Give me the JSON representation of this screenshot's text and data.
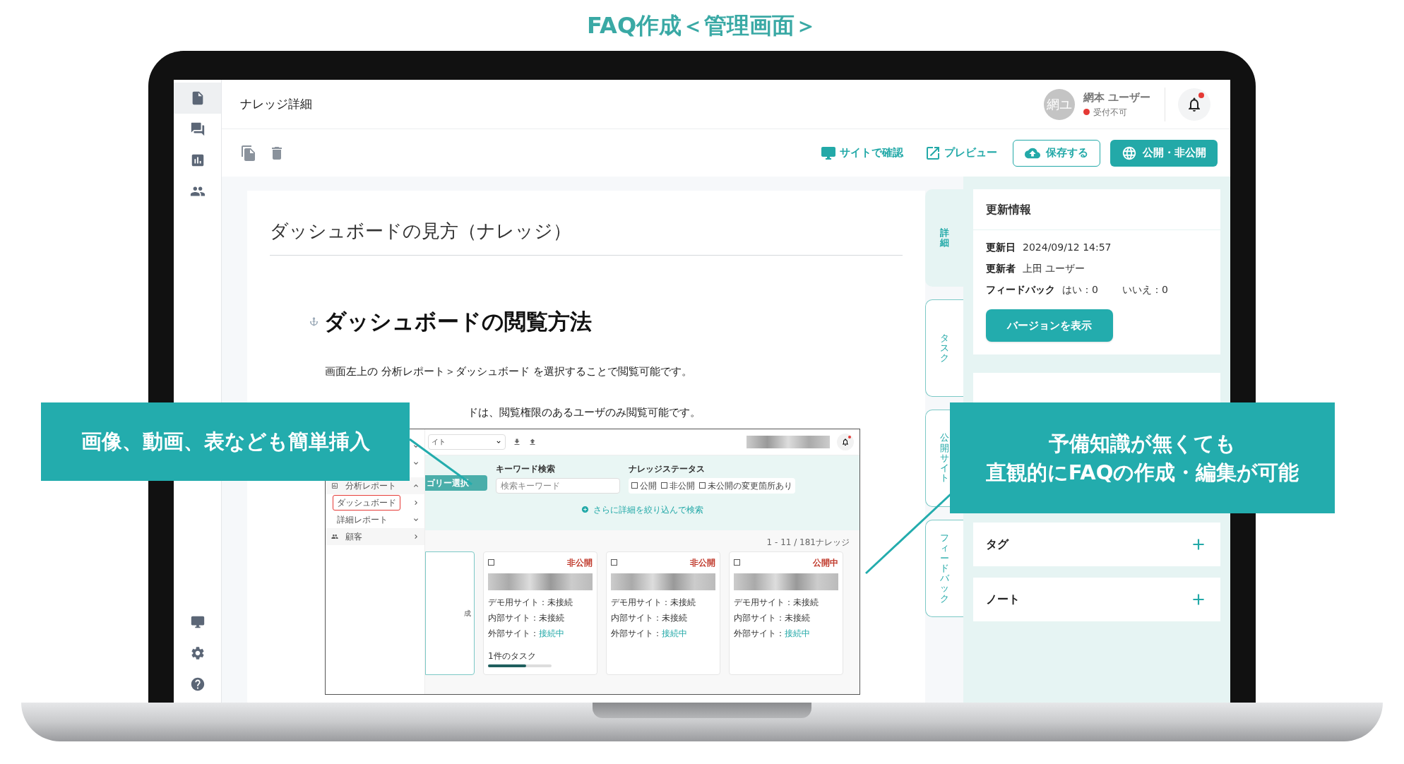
{
  "page_title": "FAQ作成＜管理画面＞",
  "sidebar": {
    "top": [
      {
        "kind": "document",
        "selected": true
      },
      {
        "kind": "chat",
        "selected": false
      },
      {
        "kind": "chart",
        "selected": false
      },
      {
        "kind": "people",
        "selected": false
      }
    ],
    "bottom": [
      {
        "kind": "monitor"
      },
      {
        "kind": "settings"
      },
      {
        "kind": "help"
      }
    ]
  },
  "header": {
    "title": "ナレッジ詳細",
    "avatar": "網ユ",
    "user_name": "網本 ユーザー",
    "user_status": "受付不可",
    "available": false,
    "unread": true
  },
  "toolbar": [
    {
      "kind": "copy"
    },
    {
      "kind": "delete"
    }
  ],
  "actions": [
    {
      "kind": "monitor-link",
      "label": "サイトで確認"
    },
    {
      "kind": "external-link",
      "label": "プレビュー"
    },
    {
      "kind": "outline",
      "label": "保存する"
    },
    {
      "kind": "primary",
      "label": "公開・非公開"
    }
  ],
  "document": {
    "title": "ダッシュボードの見方（ナレッジ）",
    "heading": "ダッシュボードの閲覧方法",
    "paragraphs": [
      "画面左上の 分析レポート＞ダッシュボード を選択することで閲覧可能です。",
      "ドは、閲覧権限のあるユーザのみ閲覧可能です。"
    ]
  },
  "embedded_screenshot": {
    "sidebar": [
      {
        "label": "分析レポート",
        "kind": "group",
        "expanded": true,
        "highlighted": false
      },
      {
        "label": "ダッシュボード",
        "kind": "page",
        "highlighted": true
      },
      {
        "label": "詳細レポート",
        "kind": "sub",
        "expanded": false,
        "highlighted": false
      },
      {
        "label": "顧客",
        "kind": "group",
        "expanded": false,
        "highlighted": false
      }
    ],
    "site_select": "イト",
    "category_button": "ゴリー選択",
    "keyword_label": "キーワード検索",
    "keyword_placeholder": "検索キーワード",
    "status_label": "ナレッジステータス",
    "status_options": [
      {
        "label": "公開",
        "checked": false
      },
      {
        "label": "非公開",
        "checked": false
      },
      {
        "label": "未公開の変更箇所あり",
        "checked": false
      }
    ],
    "more_search": "さらに詳細を絞り込んで検索",
    "count": "1 - 11 / 181ナレッジ",
    "partial_card_text": "成",
    "unread": true,
    "cards": [
      {
        "checked": false,
        "status": "非公開",
        "lines": [
          {
            "label": "デモ用サイト：",
            "value": "未接続",
            "connected": false
          },
          {
            "label": "内部サイト：",
            "value": "未接続",
            "connected": false
          },
          {
            "label": "外部サイト：",
            "value": "接続中",
            "connected": true
          }
        ],
        "task": {
          "label": "1件のタスク",
          "level": 0.6
        }
      },
      {
        "checked": false,
        "status": "非公開",
        "lines": [
          {
            "label": "デモ用サイト：",
            "value": "未接続",
            "connected": false
          },
          {
            "label": "内部サイト：",
            "value": "未接続",
            "connected": false
          },
          {
            "label": "外部サイト：",
            "value": "接続中",
            "connected": true
          }
        ]
      },
      {
        "checked": false,
        "status": "公開中",
        "lines": [
          {
            "label": "デモ用サイト：",
            "value": "未接続",
            "connected": false
          },
          {
            "label": "内部サイト：",
            "value": "未接続",
            "connected": false
          },
          {
            "label": "外部サイト：",
            "value": "接続中",
            "connected": true
          }
        ]
      }
    ]
  },
  "side_tabs": [
    {
      "label": "詳細",
      "selected": true
    },
    {
      "label": "タスク",
      "selected": false
    },
    {
      "label": "公開サイト",
      "selected": false
    },
    {
      "label": "フィードバック",
      "selected": false
    }
  ],
  "update_info": {
    "title": "更新情報",
    "rows": [
      {
        "label": "更新日",
        "values": [
          "2024/09/12 14:57"
        ]
      },
      {
        "label": "更新者",
        "values": [
          "上田 ユーザー"
        ]
      },
      {
        "label": "フィードバック",
        "values": [
          "はい：0",
          "いいえ：0"
        ]
      }
    ],
    "button": "バージョンを表示"
  },
  "sections": [
    {
      "label": "タグ"
    },
    {
      "label": "ノート"
    }
  ],
  "callouts": [
    {
      "lines": [
        "画像、動画、表なども簡単挿入"
      ]
    },
    {
      "lines": [
        "予備知識が無くても",
        "直観的にFAQの作成・編集が可能"
      ]
    }
  ]
}
